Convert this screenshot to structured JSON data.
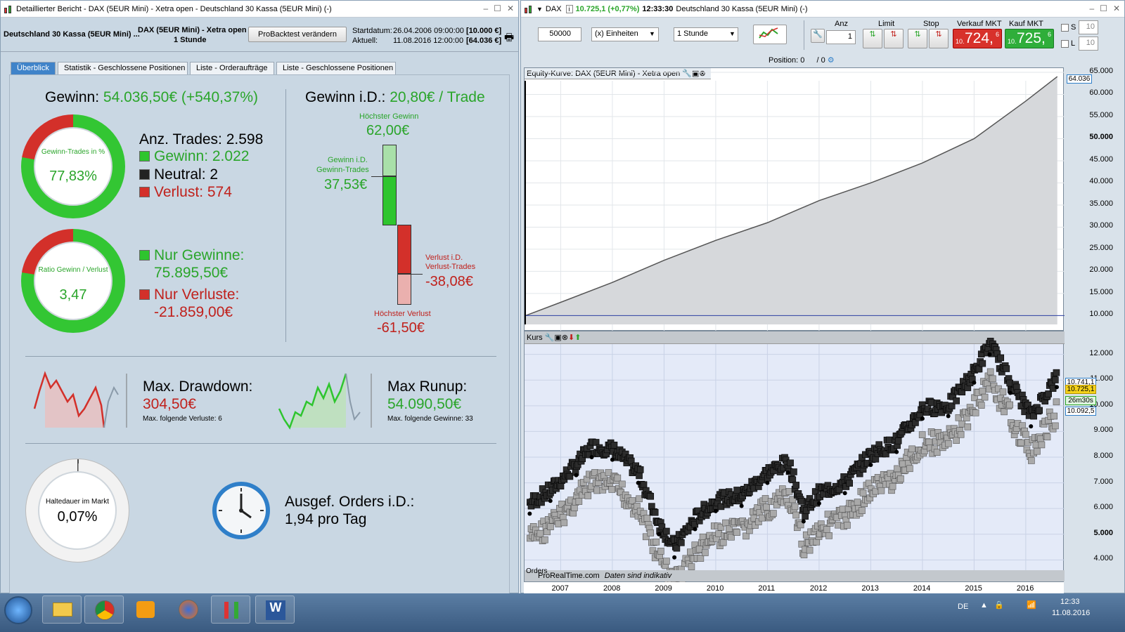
{
  "left_window": {
    "title": "Detaillierter Bericht - DAX (5EUR Mini) - Xetra open - Deutschland 30 Kassa (5EUR Mini) (-)",
    "header": {
      "instrument": "Deutschland 30 Kassa (5EUR Mini) ...",
      "market_line1": "DAX (5EUR Mini) - Xetra open",
      "market_line2": "1 Stunde",
      "button": "ProBacktest verändern",
      "start_label": "Startdatum:",
      "start_value": "26.04.2006 09:00:00",
      "start_capital": "[10.000 €]",
      "current_label": "Aktuell:",
      "current_value": "11.08.2016 12:00:00",
      "current_capital": "[64.036 €]"
    },
    "tabs": [
      "Überblick",
      "Statistik - Geschlossene Positionen",
      "Liste - Orderaufträge",
      "Liste - Geschlossene Positionen"
    ],
    "overview": {
      "gewinn_label": "Gewinn:",
      "gewinn_value": "54.036,50€ (+540,37%)",
      "ring1_label": "Gewinn-Trades in %",
      "ring1_value": "77,83%",
      "ring1_fraction": 0.7783,
      "trades_label": "Anz. Trades: 2.598",
      "gewinn_trades": "Gewinn: 2.022",
      "neutral_trades": "Neutral: 2",
      "verlust_trades": "Verlust: 574",
      "ring2_label": "Ratio Gewinn / Verlust",
      "ring2_value": "3,47",
      "ring2_fraction": 0.776,
      "nur_gewinne_label": "Nur Gewinne:",
      "nur_gewinne_value": "75.895,50€",
      "nur_verluste_label": "Nur Verluste:",
      "nur_verluste_value": "-21.859,00€",
      "gid_label": "Gewinn i.D.:",
      "gid_value": "20,80€ / Trade",
      "hoechster_gewinn_label": "Höchster Gewinn",
      "hoechster_gewinn_value": "62,00€",
      "gid_gewinn_trades_label1": "Gewinn i.D.",
      "gid_gewinn_trades_label2": "Gewinn-Trades",
      "gid_gewinn_trades_value": "37,53€",
      "vid_label1": "Verlust i.D.",
      "vid_label2": "Verlust-Trades",
      "vid_value": "-38,08€",
      "hoechster_verlust_label": "Höchster Verlust",
      "hoechster_verlust_value": "-61,50€",
      "drawdown_label": "Max. Drawdown:",
      "drawdown_value": "304,50€",
      "drawdown_sub": "Max. folgende Verluste: 6",
      "runup_label": "Max Runup:",
      "runup_value": "54.090,50€",
      "runup_sub": "Max. folgende Gewinne: 33",
      "haltedauer_label": "Haltedauer im Markt",
      "haltedauer_value": "0,07%",
      "haltedauer_fraction": 0.0007,
      "orders_label": "Ausgef. Orders i.D.:",
      "orders_value": "1,94 pro Tag"
    }
  },
  "right_window": {
    "title_symbol": "DAX",
    "title_price": "10.725,1 (+0,77%)",
    "title_time": "12:33:30",
    "title_rest": "Deutschland 30 Kassa (5EUR Mini) (-)",
    "toolbar": {
      "quantity": "50000",
      "units": "(x) Einheiten",
      "timeframe": "1 Stunde",
      "anz_label": "Anz",
      "anz_value": "1",
      "limit_label": "Limit",
      "stop_label": "Stop",
      "sell_label": "Verkauf MKT",
      "sell_small": "10.",
      "sell_big": "724,",
      "sell_sup": "6",
      "buy_label": "Kauf MKT",
      "buy_small": "10.",
      "buy_big": "725,",
      "buy_sup": "6",
      "s_label": "S",
      "l_label": "L",
      "s_value": "10",
      "l_value": "10",
      "position_label": "Position:",
      "position_value1": "0",
      "position_sep": "/ 0"
    },
    "equity_panel_title": "Equity-Kurve: DAX (5EUR Mini) - Xetra open",
    "price_panel_title": "Kurs",
    "price_tags": {
      "last": "10.725,1",
      "countdown": "26m30s",
      "level": "10.092,5",
      "top": "10.741,1",
      "equity_last": "64.036"
    },
    "footer": {
      "source": "ProRealTime.com",
      "note": "Daten sind indikativ",
      "overlay": "Orders"
    }
  },
  "chart_data": [
    {
      "type": "area",
      "title": "Equity-Kurve: DAX (5EUR Mini) - Xetra open",
      "x": [
        2006.32,
        2007,
        2008,
        2009,
        2010,
        2011,
        2012,
        2013,
        2014,
        2015,
        2016,
        2016.61
      ],
      "values": [
        10000,
        13000,
        17500,
        22500,
        27000,
        31000,
        36000,
        40000,
        44500,
        50000,
        58500,
        64036
      ],
      "ylim": [
        8000,
        65000
      ],
      "yticks": [
        "10.000",
        "15.000",
        "20.000",
        "25.000",
        "30.000",
        "35.000",
        "40.000",
        "45.000",
        "50.000",
        "55.000",
        "60.000",
        "65.000"
      ],
      "baseline": 10000,
      "grid": true
    },
    {
      "type": "scatter",
      "title": "Kurs",
      "x": [
        2006.4,
        2006.8,
        2007.3,
        2007.6,
        2008.0,
        2008.5,
        2008.9,
        2009.2,
        2009.6,
        2010.0,
        2010.5,
        2011.0,
        2011.4,
        2011.7,
        2012.0,
        2012.5,
        2013.0,
        2013.5,
        2014.0,
        2014.5,
        2015.0,
        2015.3,
        2015.7,
        2016.1,
        2016.6
      ],
      "values": [
        5800,
        6300,
        7300,
        8000,
        7900,
        7000,
        5000,
        4100,
        5200,
        5900,
        6100,
        7000,
        7400,
        5500,
        6200,
        6600,
        7700,
        8200,
        9500,
        9600,
        10900,
        12000,
        10500,
        9200,
        10725
      ],
      "ylim": [
        3600,
        12400
      ],
      "yticks": [
        "4.000",
        "5.000",
        "6.000",
        "7.000",
        "8.000",
        "9.000",
        "10.000",
        "11.000",
        "12.000"
      ],
      "xticks": [
        "2007",
        "2008",
        "2009",
        "2010",
        "2011",
        "2012",
        "2013",
        "2014",
        "2015",
        "2016"
      ]
    }
  ],
  "taskbar": {
    "lang": "DE",
    "time": "12:33",
    "date": "11.08.2016"
  }
}
